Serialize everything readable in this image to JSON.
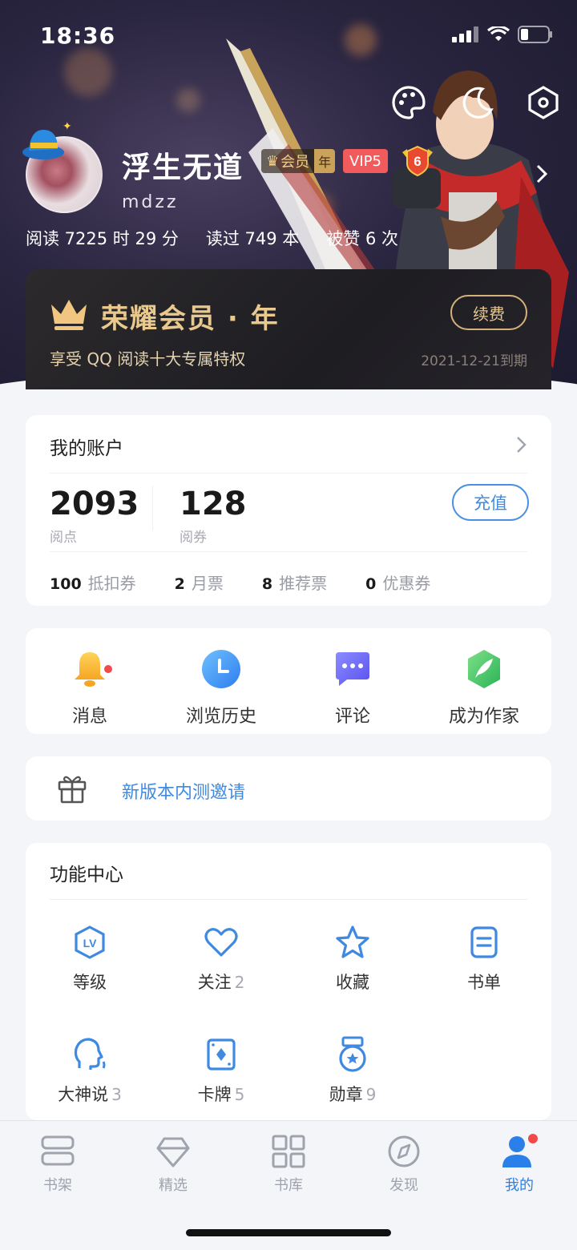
{
  "status_bar": {
    "time": "18:36"
  },
  "profile": {
    "username": "浮生无道",
    "handle": "mdzz",
    "member_label": "会员",
    "member_period": "年",
    "vip": "VIP5",
    "level": "6",
    "stats": [
      "阅读 7225 时 29 分",
      "读过 749 本",
      "被赞 6 次"
    ]
  },
  "honor": {
    "title": "荣耀会员 · 年",
    "subtitle": "享受 QQ 阅读十大专属特权",
    "expire": "2021-12-21到期",
    "renew": "续费",
    "colors": {
      "gold": "#e9c98d"
    }
  },
  "account": {
    "title": "我的账户",
    "points_value": "2093",
    "points_label": "阅点",
    "coupons_value": "128",
    "coupons_label": "阅券",
    "recharge": "充值",
    "tickets": [
      {
        "n": "100",
        "label": "抵扣券"
      },
      {
        "n": "2",
        "label": "月票"
      },
      {
        "n": "8",
        "label": "推荐票"
      },
      {
        "n": "0",
        "label": "优惠券"
      }
    ]
  },
  "quick": {
    "items": [
      {
        "label": "消息",
        "icon": "bell-icon"
      },
      {
        "label": "浏览历史",
        "icon": "clock-icon"
      },
      {
        "label": "评论",
        "icon": "comment-icon"
      },
      {
        "label": "成为作家",
        "icon": "feather-icon"
      }
    ]
  },
  "invite": {
    "text": "新版本内测邀请",
    "icon": "gift-icon"
  },
  "func": {
    "title": "功能中心",
    "items": [
      {
        "label": "等级",
        "count": "",
        "icon": "level-icon"
      },
      {
        "label": "关注",
        "count": "2",
        "icon": "heart-icon"
      },
      {
        "label": "收藏",
        "count": "",
        "icon": "star-icon"
      },
      {
        "label": "书单",
        "count": "",
        "icon": "booklist-icon"
      },
      {
        "label": "大神说",
        "count": "3",
        "icon": "voice-icon"
      },
      {
        "label": "卡牌",
        "count": "5",
        "icon": "card-icon"
      },
      {
        "label": "勋章",
        "count": "9",
        "icon": "medal-icon"
      }
    ]
  },
  "tabs": [
    {
      "label": "书架",
      "icon": "bookshelf-icon"
    },
    {
      "label": "精选",
      "icon": "diamond-icon"
    },
    {
      "label": "书库",
      "icon": "grid-icon"
    },
    {
      "label": "发现",
      "icon": "compass-icon"
    },
    {
      "label": "我的",
      "icon": "profile-icon",
      "active": true
    }
  ],
  "colors": {
    "accent": "#3f8ae0",
    "vip_red": "#f25b5b",
    "badge_red": "#f04a4a"
  }
}
